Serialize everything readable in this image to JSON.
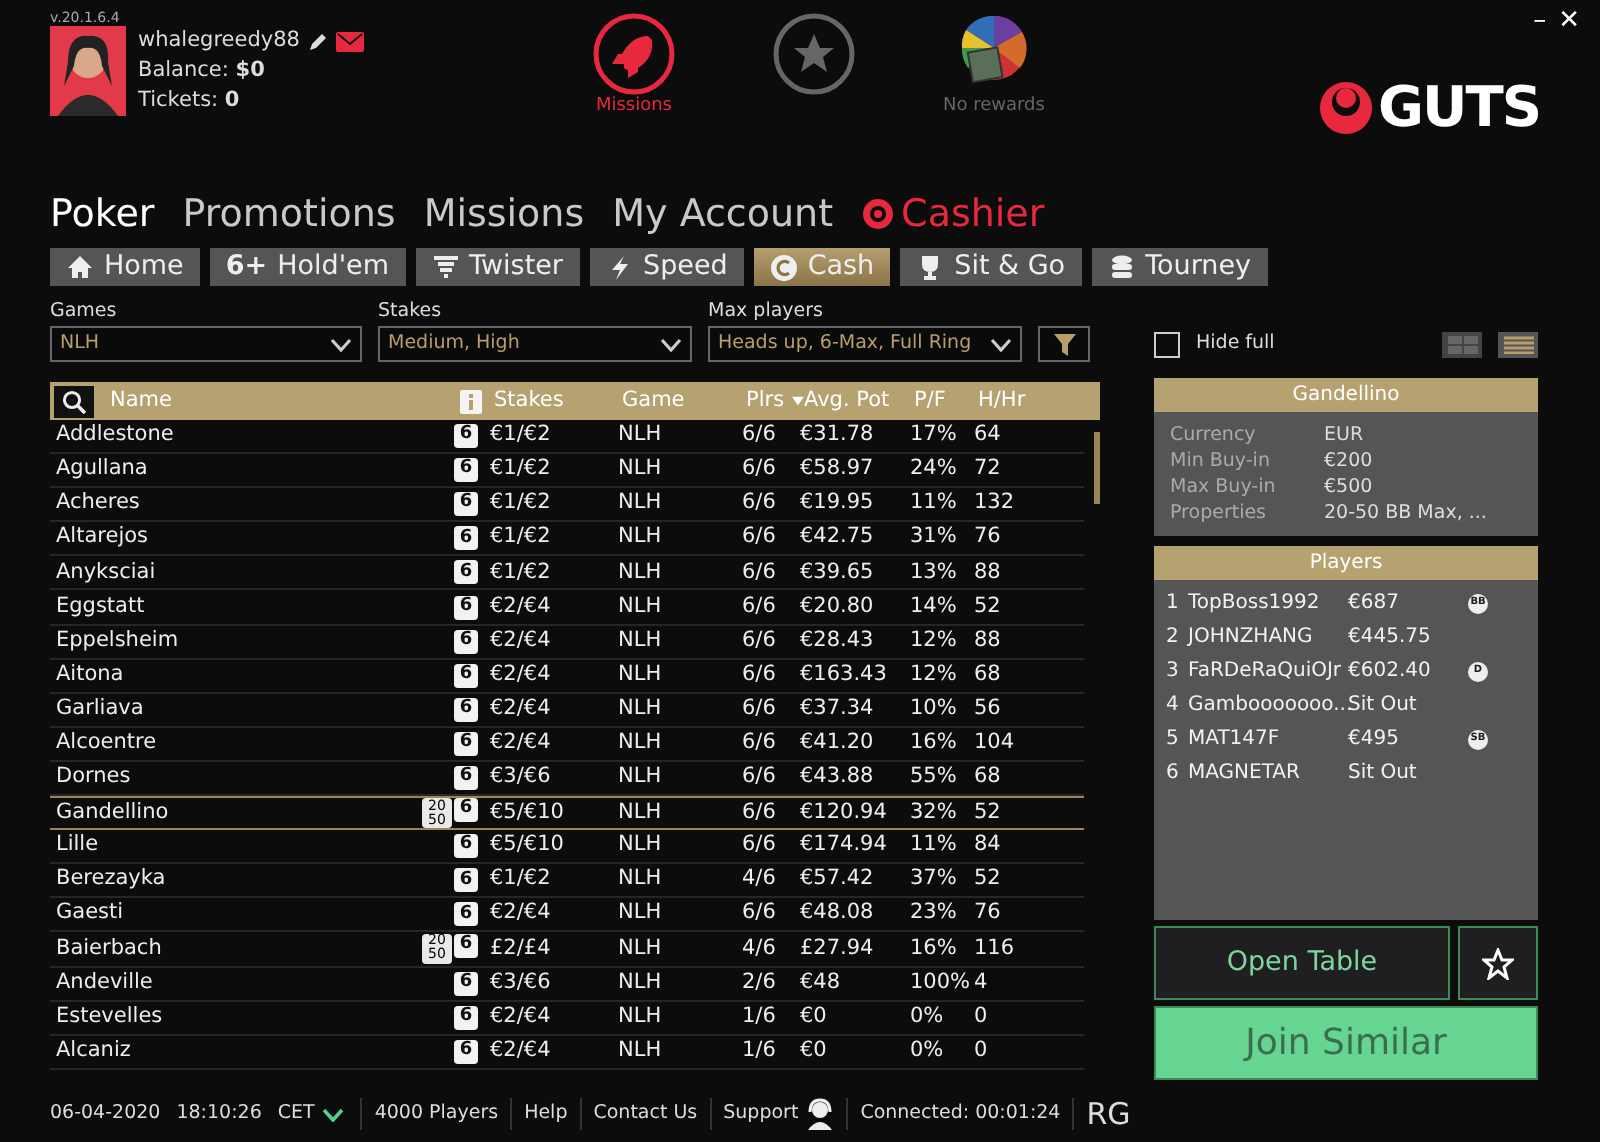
{
  "version": "v.20.1.6.4",
  "user": {
    "name": "whalegreedy88",
    "balance_label": "Balance:",
    "balance": "$0",
    "tickets_label": "Tickets:",
    "tickets": "0"
  },
  "top_icons": [
    {
      "kind": "missions",
      "label": "Missions"
    },
    {
      "kind": "star"
    },
    {
      "kind": "rewards",
      "label": "No rewards"
    }
  ],
  "logo": "GUTS",
  "window_buttons": [
    "–",
    "✕"
  ],
  "main_nav": [
    {
      "label": "Poker",
      "selected": true,
      "kind": "plain"
    },
    {
      "label": "Promotions",
      "selected": false,
      "kind": "plain"
    },
    {
      "label": "Missions",
      "selected": false,
      "kind": "plain"
    },
    {
      "label": "My Account",
      "selected": false,
      "kind": "plain"
    },
    {
      "label": "Cashier",
      "selected": false,
      "kind": "cashier"
    }
  ],
  "tabs": [
    {
      "label": "Home",
      "kind": "home",
      "selected": false
    },
    {
      "label": "Hold'em",
      "prefix": "6+",
      "kind": "holdem",
      "selected": false
    },
    {
      "label": "Twister",
      "kind": "twister",
      "selected": false
    },
    {
      "label": "Speed",
      "kind": "speed",
      "selected": false
    },
    {
      "label": "Cash",
      "kind": "cash",
      "selected": true
    },
    {
      "label": "Sit & Go",
      "kind": "sitgo",
      "selected": false
    },
    {
      "label": "Tourney",
      "kind": "tourney",
      "selected": false
    }
  ],
  "filters": [
    {
      "label": "Games",
      "value": "NLH"
    },
    {
      "label": "Stakes",
      "value": "Medium, High"
    },
    {
      "label": "Max players",
      "value": "Heads up, 6-Max, Full Ring"
    }
  ],
  "hide_full": {
    "label": "Hide full",
    "checked": false
  },
  "view_modes": [
    {
      "kind": "grid",
      "selected": false
    },
    {
      "kind": "list",
      "selected": true
    }
  ],
  "table": {
    "columns": [
      "Name",
      "Stakes",
      "Game",
      "Plrs",
      "Avg. Pot",
      "P/F",
      "H/Hr"
    ],
    "rows": [
      {
        "name": "Addlestone",
        "seats": "6",
        "stakes": "€1/€2",
        "game": "NLH",
        "plrs": "6/6",
        "avg_pot": "€31.78",
        "pf": "17%",
        "hhr": "64",
        "selected": false
      },
      {
        "name": "Agullana",
        "seats": "6",
        "stakes": "€1/€2",
        "game": "NLH",
        "plrs": "6/6",
        "avg_pot": "€58.97",
        "pf": "24%",
        "hhr": "72",
        "selected": false
      },
      {
        "name": "Acheres",
        "seats": "6",
        "stakes": "€1/€2",
        "game": "NLH",
        "plrs": "6/6",
        "avg_pot": "€19.95",
        "pf": "11%",
        "hhr": "132",
        "selected": false
      },
      {
        "name": "Altarejos",
        "seats": "6",
        "stakes": "€1/€2",
        "game": "NLH",
        "plrs": "6/6",
        "avg_pot": "€42.75",
        "pf": "31%",
        "hhr": "76",
        "selected": false
      },
      {
        "name": "Anyksciai",
        "seats": "6",
        "stakes": "€1/€2",
        "game": "NLH",
        "plrs": "6/6",
        "avg_pot": "€39.65",
        "pf": "13%",
        "hhr": "88",
        "selected": false
      },
      {
        "name": "Eggstatt",
        "seats": "6",
        "stakes": "€2/€4",
        "game": "NLH",
        "plrs": "6/6",
        "avg_pot": "€20.80",
        "pf": "14%",
        "hhr": "52",
        "selected": false
      },
      {
        "name": "Eppelsheim",
        "seats": "6",
        "stakes": "€2/€4",
        "game": "NLH",
        "plrs": "6/6",
        "avg_pot": "€28.43",
        "pf": "12%",
        "hhr": "88",
        "selected": false
      },
      {
        "name": "Aitona",
        "seats": "6",
        "stakes": "€2/€4",
        "game": "NLH",
        "plrs": "6/6",
        "avg_pot": "€163.43",
        "pf": "12%",
        "hhr": "68",
        "selected": false
      },
      {
        "name": "Garliava",
        "seats": "6",
        "stakes": "€2/€4",
        "game": "NLH",
        "plrs": "6/6",
        "avg_pot": "€37.34",
        "pf": "10%",
        "hhr": "56",
        "selected": false
      },
      {
        "name": "Alcoentre",
        "seats": "6",
        "stakes": "€2/€4",
        "game": "NLH",
        "plrs": "6/6",
        "avg_pot": "€41.20",
        "pf": "16%",
        "hhr": "104",
        "selected": false
      },
      {
        "name": "Dornes",
        "seats": "6",
        "stakes": "€3/€6",
        "game": "NLH",
        "plrs": "6/6",
        "avg_pot": "€43.88",
        "pf": "55%",
        "hhr": "68",
        "selected": false
      },
      {
        "name": "Gandellino",
        "deep": [
          "20",
          "50"
        ],
        "seats": "6",
        "stakes": "€5/€10",
        "game": "NLH",
        "plrs": "6/6",
        "avg_pot": "€120.94",
        "pf": "32%",
        "hhr": "52",
        "selected": true
      },
      {
        "name": "Lille",
        "seats": "6",
        "stakes": "€5/€10",
        "game": "NLH",
        "plrs": "6/6",
        "avg_pot": "€174.94",
        "pf": "11%",
        "hhr": "84",
        "selected": false
      },
      {
        "name": "Berezayka",
        "seats": "6",
        "stakes": "€1/€2",
        "game": "NLH",
        "plrs": "4/6",
        "avg_pot": "€57.42",
        "pf": "37%",
        "hhr": "52",
        "selected": false
      },
      {
        "name": "Gaesti",
        "seats": "6",
        "stakes": "€2/€4",
        "game": "NLH",
        "plrs": "6/6",
        "avg_pot": "€48.08",
        "pf": "23%",
        "hhr": "76",
        "selected": false
      },
      {
        "name": "Baierbach",
        "deep": [
          "20",
          "50"
        ],
        "seats": "6",
        "stakes": "£2/£4",
        "game": "NLH",
        "plrs": "4/6",
        "avg_pot": "£27.94",
        "pf": "16%",
        "hhr": "116",
        "selected": false
      },
      {
        "name": "Andeville",
        "seats": "6",
        "stakes": "€3/€6",
        "game": "NLH",
        "plrs": "2/6",
        "avg_pot": "€48",
        "pf": "100%",
        "hhr": "4",
        "selected": false
      },
      {
        "name": "Estevelles",
        "seats": "6",
        "stakes": "€2/€4",
        "game": "NLH",
        "plrs": "1/6",
        "avg_pot": "€0",
        "pf": "0%",
        "hhr": "0",
        "selected": false
      },
      {
        "name": "Alcaniz",
        "seats": "6",
        "stakes": "€2/€4",
        "game": "NLH",
        "plrs": "1/6",
        "avg_pot": "€0",
        "pf": "0%",
        "hhr": "0",
        "selected": false
      }
    ]
  },
  "details": {
    "title": "Gandellino",
    "fields": [
      {
        "label": "Currency",
        "value": "EUR"
      },
      {
        "label": "Min Buy-in",
        "value": "€200"
      },
      {
        "label": "Max Buy-in",
        "value": "€500"
      },
      {
        "label": "Properties",
        "value": "20-50 BB Max, ..."
      }
    ]
  },
  "players": {
    "title": "Players",
    "rows": [
      {
        "seat": "1",
        "name": "TopBoss1992",
        "amount": "€687",
        "marker": "BB"
      },
      {
        "seat": "2",
        "name": "JOHNZHANG",
        "amount": "€445.75"
      },
      {
        "seat": "3",
        "name": "FaRDeRaQuiOJr",
        "amount": "€602.40",
        "marker": "D"
      },
      {
        "seat": "4",
        "name": "Gambooooooo...",
        "amount": "Sit Out"
      },
      {
        "seat": "5",
        "name": "MAT147F",
        "amount": "€495",
        "marker": "SB"
      },
      {
        "seat": "6",
        "name": "MAGNETAR",
        "amount": "Sit Out"
      }
    ]
  },
  "actions": {
    "open": "Open Table",
    "join": "Join Similar"
  },
  "status_bar": {
    "date": "06-04-2020",
    "time": "18:10:26",
    "timezone": "CET",
    "players": "4000 Players",
    "links": [
      "Help",
      "Contact Us"
    ],
    "support": "Support",
    "connected": "Connected: 00:01:24",
    "rg": "RG"
  }
}
